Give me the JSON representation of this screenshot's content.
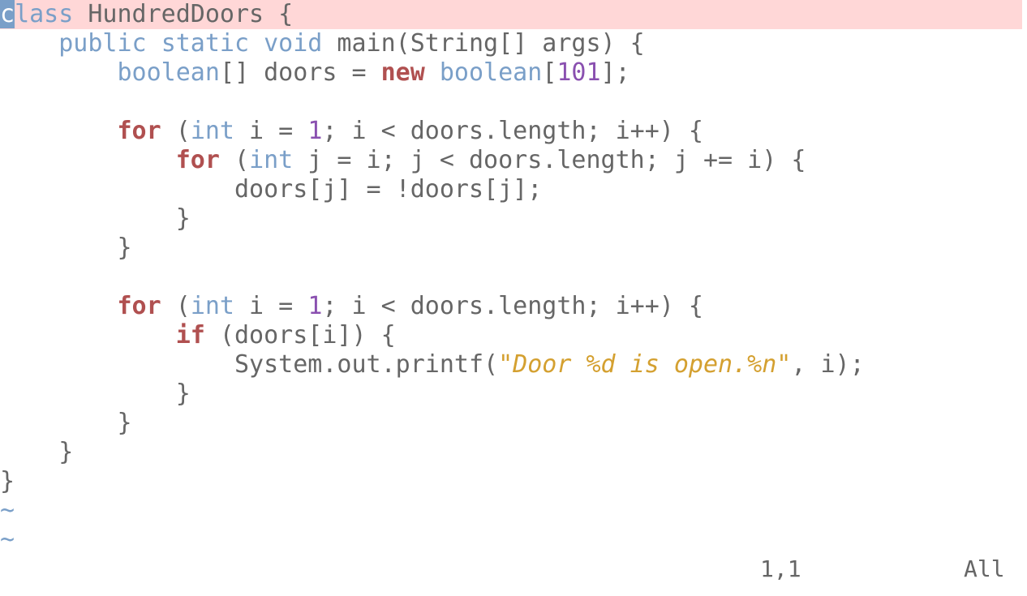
{
  "colors": {
    "background": "#ffffff",
    "cursorline": "#ffd7d7",
    "keyword": "#b05050",
    "type": "#7a9fc8",
    "number": "#8a50b0",
    "string": "#d4a030",
    "text": "#666666"
  },
  "editor": {
    "lines": [
      [
        {
          "t": "c",
          "k": "cursor"
        },
        {
          "t": "lass",
          "k": "type"
        },
        {
          "t": " HundredDoors {",
          "k": "plain"
        }
      ],
      [
        {
          "t": "    ",
          "k": "plain"
        },
        {
          "t": "public",
          "k": "type"
        },
        {
          "t": " ",
          "k": "plain"
        },
        {
          "t": "static",
          "k": "type"
        },
        {
          "t": " ",
          "k": "plain"
        },
        {
          "t": "void",
          "k": "type"
        },
        {
          "t": " main(String[] args) {",
          "k": "plain"
        }
      ],
      [
        {
          "t": "        ",
          "k": "plain"
        },
        {
          "t": "boolean",
          "k": "type"
        },
        {
          "t": "[] doors = ",
          "k": "plain"
        },
        {
          "t": "new",
          "k": "kw"
        },
        {
          "t": " ",
          "k": "plain"
        },
        {
          "t": "boolean",
          "k": "type"
        },
        {
          "t": "[",
          "k": "plain"
        },
        {
          "t": "101",
          "k": "num"
        },
        {
          "t": "];",
          "k": "plain"
        }
      ],
      [
        {
          "t": "",
          "k": "plain"
        }
      ],
      [
        {
          "t": "        ",
          "k": "plain"
        },
        {
          "t": "for",
          "k": "kw"
        },
        {
          "t": " (",
          "k": "plain"
        },
        {
          "t": "int",
          "k": "type"
        },
        {
          "t": " i = ",
          "k": "plain"
        },
        {
          "t": "1",
          "k": "num"
        },
        {
          "t": "; i < doors.length; i++) {",
          "k": "plain"
        }
      ],
      [
        {
          "t": "            ",
          "k": "plain"
        },
        {
          "t": "for",
          "k": "kw"
        },
        {
          "t": " (",
          "k": "plain"
        },
        {
          "t": "int",
          "k": "type"
        },
        {
          "t": " j = i; j < doors.length; j += i) {",
          "k": "plain"
        }
      ],
      [
        {
          "t": "                doors[j] = !doors[j];",
          "k": "plain"
        }
      ],
      [
        {
          "t": "            }",
          "k": "plain"
        }
      ],
      [
        {
          "t": "        }",
          "k": "plain"
        }
      ],
      [
        {
          "t": "",
          "k": "plain"
        }
      ],
      [
        {
          "t": "        ",
          "k": "plain"
        },
        {
          "t": "for",
          "k": "kw"
        },
        {
          "t": " (",
          "k": "plain"
        },
        {
          "t": "int",
          "k": "type"
        },
        {
          "t": " i = ",
          "k": "plain"
        },
        {
          "t": "1",
          "k": "num"
        },
        {
          "t": "; i < doors.length; i++) {",
          "k": "plain"
        }
      ],
      [
        {
          "t": "            ",
          "k": "plain"
        },
        {
          "t": "if",
          "k": "kw"
        },
        {
          "t": " (doors[i]) {",
          "k": "plain"
        }
      ],
      [
        {
          "t": "                System.out.printf(",
          "k": "plain"
        },
        {
          "t": "\"Door %d is open.%n\"",
          "k": "str"
        },
        {
          "t": ", i);",
          "k": "plain"
        }
      ],
      [
        {
          "t": "            }",
          "k": "plain"
        }
      ],
      [
        {
          "t": "        }",
          "k": "plain"
        }
      ],
      [
        {
          "t": "    }",
          "k": "plain"
        }
      ],
      [
        {
          "t": "}",
          "k": "plain"
        }
      ],
      [
        {
          "t": "~",
          "k": "tilde"
        }
      ],
      [
        {
          "t": "~",
          "k": "tilde"
        }
      ]
    ]
  },
  "statusline": {
    "ruler": "1,1",
    "percent": "All"
  }
}
